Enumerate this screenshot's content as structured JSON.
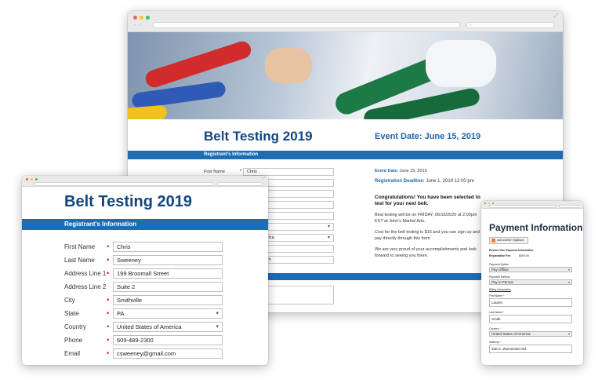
{
  "main_window": {
    "event_title": "Belt Testing 2019",
    "event_date": "Event Date: June 15, 2019",
    "section_header": "Registrant's Information",
    "fields": [
      {
        "label": "First Name",
        "value": "Chris"
      },
      {
        "label": "",
        "value": ""
      },
      {
        "label": "",
        "value": "all Street"
      },
      {
        "label": "",
        "value": ""
      },
      {
        "label": "",
        "value": ""
      },
      {
        "label": "",
        "value": ""
      },
      {
        "label": "",
        "value": "tes of America"
      },
      {
        "label": "",
        "value": "300"
      },
      {
        "label": "",
        "value": "@gmail.com"
      }
    ],
    "info": {
      "event_date_label": "Event Date:",
      "event_date_value": "June 15, 2019",
      "deadline_label": "Registration Deadline:",
      "deadline_value": "June 1, 2019  12:00  pm",
      "congrats": "Congratulations! You have been selected to test for your next belt.",
      "paragraph_1": "Best testing will be on FRIDAY, 06/15/2020 at 2:00pm EST at John's Martial Arts.",
      "paragraph_2": "Cost for the belt testing is $15 and you can sign up and pay directly through this form.",
      "paragraph_3": "We are very proud of your accomplishments and look forward to seeing you there."
    }
  },
  "left_window": {
    "title": "Belt Testing 2019",
    "section_header": "Registrant's Information",
    "fields": [
      {
        "label": "First Name",
        "required": true,
        "value": "Chris",
        "type": "text"
      },
      {
        "label": "Last Name",
        "required": true,
        "value": "Sweeney",
        "type": "text"
      },
      {
        "label": "Address Line 1",
        "required": true,
        "value": "199 Broomall Street",
        "type": "text"
      },
      {
        "label": "Address Line 2",
        "required": false,
        "value": "Suite 2",
        "type": "text"
      },
      {
        "label": "City",
        "required": true,
        "value": "Smithville",
        "type": "text"
      },
      {
        "label": "State",
        "required": true,
        "value": "PA",
        "type": "select"
      },
      {
        "label": "Country",
        "required": true,
        "value": "United States of America",
        "type": "select"
      },
      {
        "label": "Phone",
        "required": true,
        "value": "609-489-2300",
        "type": "text"
      },
      {
        "label": "Email",
        "required": true,
        "value": "csweeney@gmail.com",
        "type": "text"
      }
    ]
  },
  "right_window": {
    "title": "Payment Information",
    "add_button": "add another registrant",
    "review_heading": "Review Your Payment Information",
    "fee_label": "Registration Fee",
    "fee_value": "$000.00",
    "payment_option_label": "Payment Option",
    "payment_option_value": "Pay Offline",
    "payment_method_label": "Payment Method",
    "payment_method_value": "Pay in Person",
    "billing_link": "Billing Information",
    "first_name_label": "First Name",
    "first_name_value": "Lauren",
    "last_name_label": "Last Name",
    "last_name_value": "Smith",
    "country_label": "Country",
    "country_value": "United States of America",
    "address_label": "Address",
    "address_value": "330 S. Warminster Rd."
  },
  "icons": {
    "required_marker": "•",
    "dropdown": "▾",
    "expand": "⤢"
  },
  "colors": {
    "title_blue": "#12467f",
    "section_bar": "#1d6db5",
    "required_red": "#c8102e"
  }
}
